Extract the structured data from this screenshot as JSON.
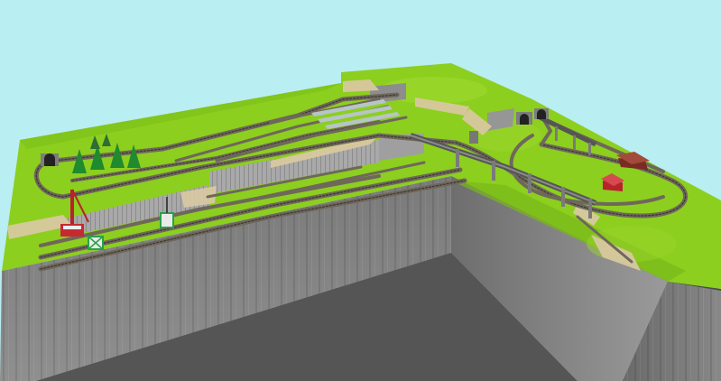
{
  "scene": {
    "kind": "3d-model-railway-layout-view",
    "colors": {
      "sky": "#b9eef2",
      "grass": "#8ccf1e",
      "grass_dark": "#74b81a",
      "cliff_face": "#8a8a8a",
      "cliff_dark": "#5e5e5e",
      "floor": "#4c4c4c",
      "track": "#6f675c",
      "rail": "#3b3731",
      "rock": "#d9c9a3",
      "tree": "#1f8a2e",
      "building_red": "#b8232b",
      "tunnel": "#7d7d7d"
    },
    "icons": [
      "tree-icon",
      "crane-icon",
      "tunnel-portal-icon",
      "station-building-icon",
      "signal-icon"
    ]
  }
}
